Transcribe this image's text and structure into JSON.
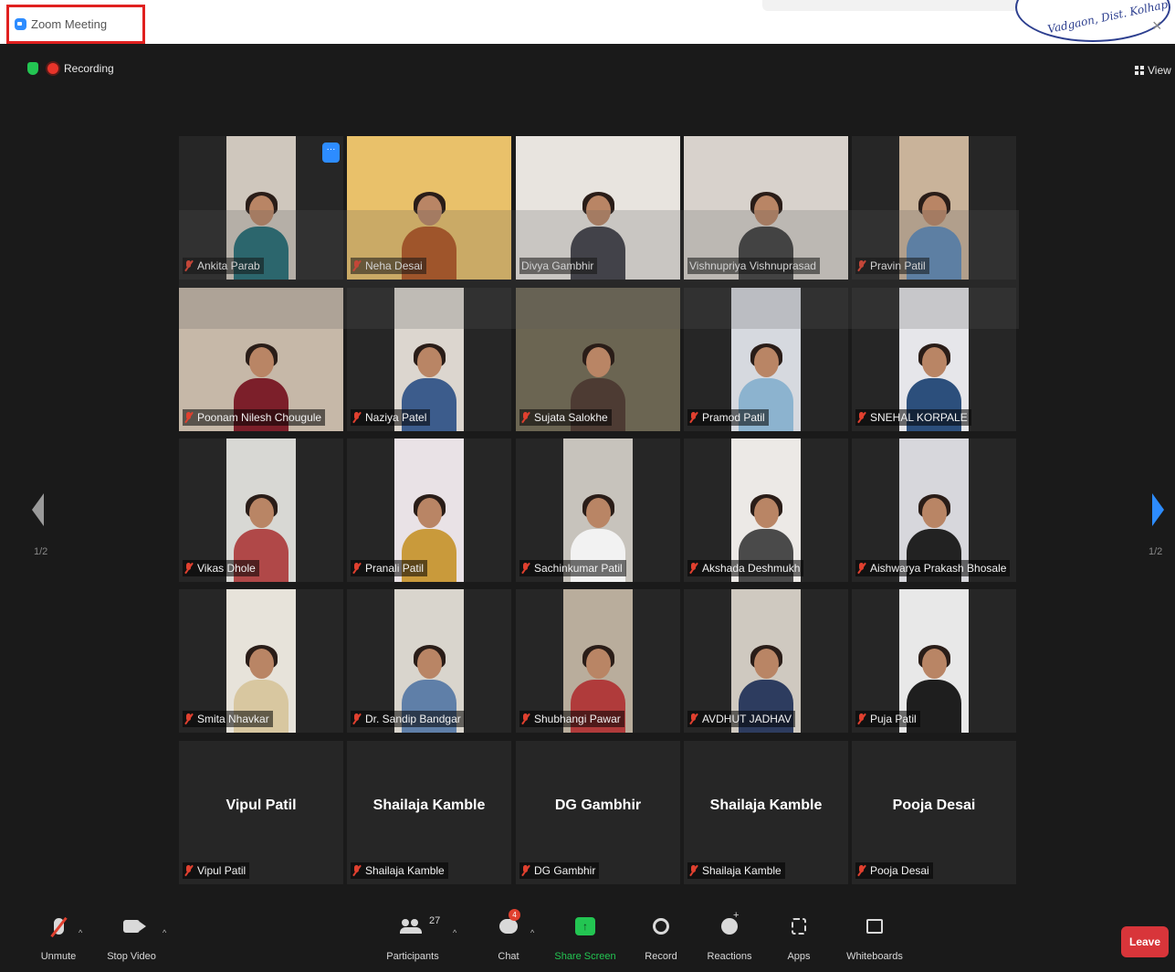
{
  "window": {
    "title": "Zoom Meeting",
    "stamp_text": "Vadgaon, Dist. Kolhapur"
  },
  "meeting": {
    "recording_label": "Recording",
    "view_label": "View",
    "page_indicator_left": "1/2",
    "page_indicator_right": "1/2"
  },
  "participants_grid": [
    {
      "name": "Ankita Parab",
      "muted": true,
      "video": true
    },
    {
      "name": "Neha Desai",
      "muted": true,
      "video": true
    },
    {
      "name": "Divya Gambhir",
      "muted": false,
      "video": true
    },
    {
      "name": "Vishnupriya Vishnuprasad",
      "muted": false,
      "video": true,
      "active_speaker": true
    },
    {
      "name": "Pravin Patil",
      "muted": true,
      "video": true
    },
    {
      "name": "Poonam Nilesh Chougule",
      "muted": true,
      "video": true
    },
    {
      "name": "Naziya Patel",
      "muted": true,
      "video": true
    },
    {
      "name": "Sujata Salokhe",
      "muted": true,
      "video": true
    },
    {
      "name": "Pramod Patil",
      "muted": true,
      "video": true
    },
    {
      "name": "SNEHAL KORPALE",
      "muted": true,
      "video": true
    },
    {
      "name": "Vikas Dhole",
      "muted": true,
      "video": true
    },
    {
      "name": "Pranali Patil",
      "muted": true,
      "video": true
    },
    {
      "name": "Sachinkumar Patil",
      "muted": true,
      "video": true
    },
    {
      "name": "Akshada Deshmukh",
      "muted": true,
      "video": true
    },
    {
      "name": "Aishwarya Prakash Bhosale",
      "muted": true,
      "video": true
    },
    {
      "name": "Smita Nhavkar",
      "muted": true,
      "video": true
    },
    {
      "name": "Dr. Sandip Bandgar",
      "muted": true,
      "video": true
    },
    {
      "name": "Shubhangi Pawar",
      "muted": true,
      "video": true
    },
    {
      "name": "AVDHUT JADHAV",
      "muted": true,
      "video": true
    },
    {
      "name": "Puja Patil",
      "muted": true,
      "video": true
    },
    {
      "name": "Vipul Patil",
      "muted": true,
      "video": false,
      "center_name": "Vipul Patil"
    },
    {
      "name": "Shailaja Kamble",
      "muted": true,
      "video": false,
      "center_name": "Shailaja Kamble"
    },
    {
      "name": "DG Gambhir",
      "muted": true,
      "video": false,
      "center_name": "DG Gambhir"
    },
    {
      "name": "Shailaja Kamble",
      "muted": true,
      "video": false,
      "center_name": "Shailaja Kamble"
    },
    {
      "name": "Pooja Desai",
      "muted": true,
      "video": false,
      "center_name": "Pooja Desai"
    }
  ],
  "toolbar": {
    "unmute": "Unmute",
    "stop_video": "Stop Video",
    "participants": "Participants",
    "participant_count": "27",
    "chat": "Chat",
    "chat_badge": "4",
    "share_screen": "Share Screen",
    "record": "Record",
    "reactions": "Reactions",
    "apps": "Apps",
    "whiteboards": "Whiteboards",
    "leave": "Leave"
  },
  "colors": {
    "accent": "#2d8cff",
    "share_green": "#23c552",
    "leave_red": "#d8353a",
    "active_border": "#c7e84f",
    "annotation_red": "#e0201f"
  }
}
